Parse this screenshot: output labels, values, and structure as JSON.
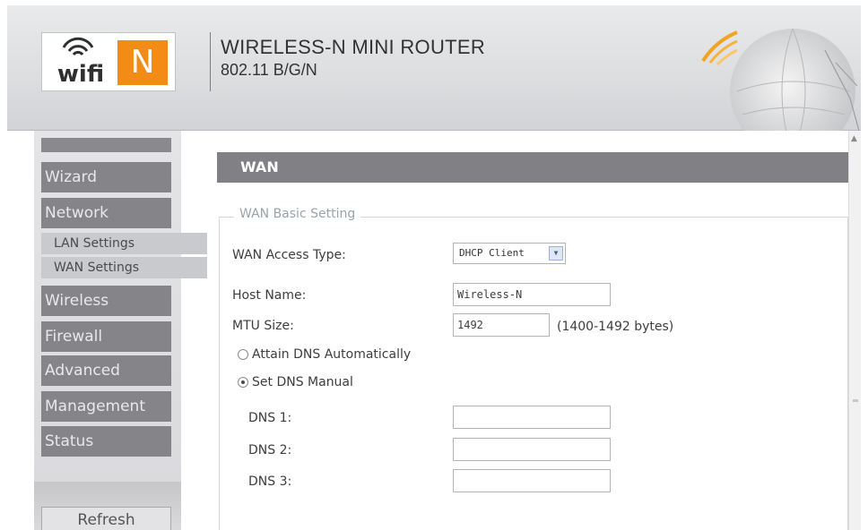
{
  "header": {
    "logo_text": "wifi",
    "logo_badge": "N",
    "product_title": "WIRELESS-N MINI ROUTER",
    "product_subtitle": "802.11 B/G/N"
  },
  "sidebar": {
    "items": [
      {
        "label": "Wizard"
      },
      {
        "label": "Network"
      },
      {
        "label": "LAN Settings"
      },
      {
        "label": "WAN Settings"
      },
      {
        "label": "Wireless"
      },
      {
        "label": "Firewall"
      },
      {
        "label": "Advanced"
      },
      {
        "label": "Management"
      },
      {
        "label": "Status"
      }
    ],
    "refresh_label": "Refresh"
  },
  "main": {
    "section_title": "WAN",
    "fieldset_legend": "WAN Basic Setting",
    "wan_access_type": {
      "label": "WAN Access Type:",
      "value": "DHCP Client"
    },
    "host_name": {
      "label": "Host Name:",
      "value": "Wireless-N"
    },
    "mtu_size": {
      "label": "MTU Size:",
      "value": "1492",
      "hint": "(1400-1492 bytes)"
    },
    "dns_auto": {
      "label": "Attain DNS Automatically",
      "checked": false
    },
    "dns_manual": {
      "label": "Set DNS Manual",
      "checked": true
    },
    "dns1": {
      "label": "DNS 1:",
      "value": ""
    },
    "dns2": {
      "label": "DNS 2:",
      "value": ""
    },
    "dns3": {
      "label": "DNS 3:",
      "value": ""
    }
  },
  "colors": {
    "nav_item": "#858589",
    "section_bar": "#818185",
    "logo_accent": "#f28c17"
  }
}
